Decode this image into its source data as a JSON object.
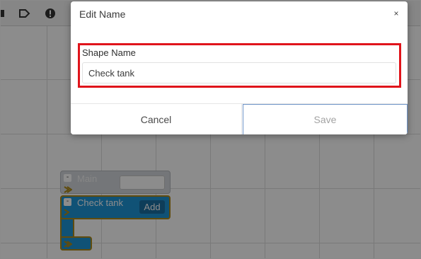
{
  "modal": {
    "title": "Edit Name",
    "close_icon": "×",
    "field_label": "Shape Name",
    "field_value": "Check tank",
    "cancel_label": "Cancel",
    "save_label": "Save",
    "highlight_color": "#e0141b"
  },
  "workspace": {
    "toolbar_icons": [
      "label-tag-icon",
      "alert-circle-icon"
    ],
    "blocks": {
      "main": {
        "label": "Main",
        "collapse": "-"
      },
      "check": {
        "label": "Check tank",
        "collapse": "-",
        "add_label": "Add"
      }
    },
    "colors": {
      "block_main": "#d3d7dc",
      "block_check": "#1e95d8",
      "block_border": "#b08a1a",
      "add_button": "#1a6fa3"
    }
  }
}
